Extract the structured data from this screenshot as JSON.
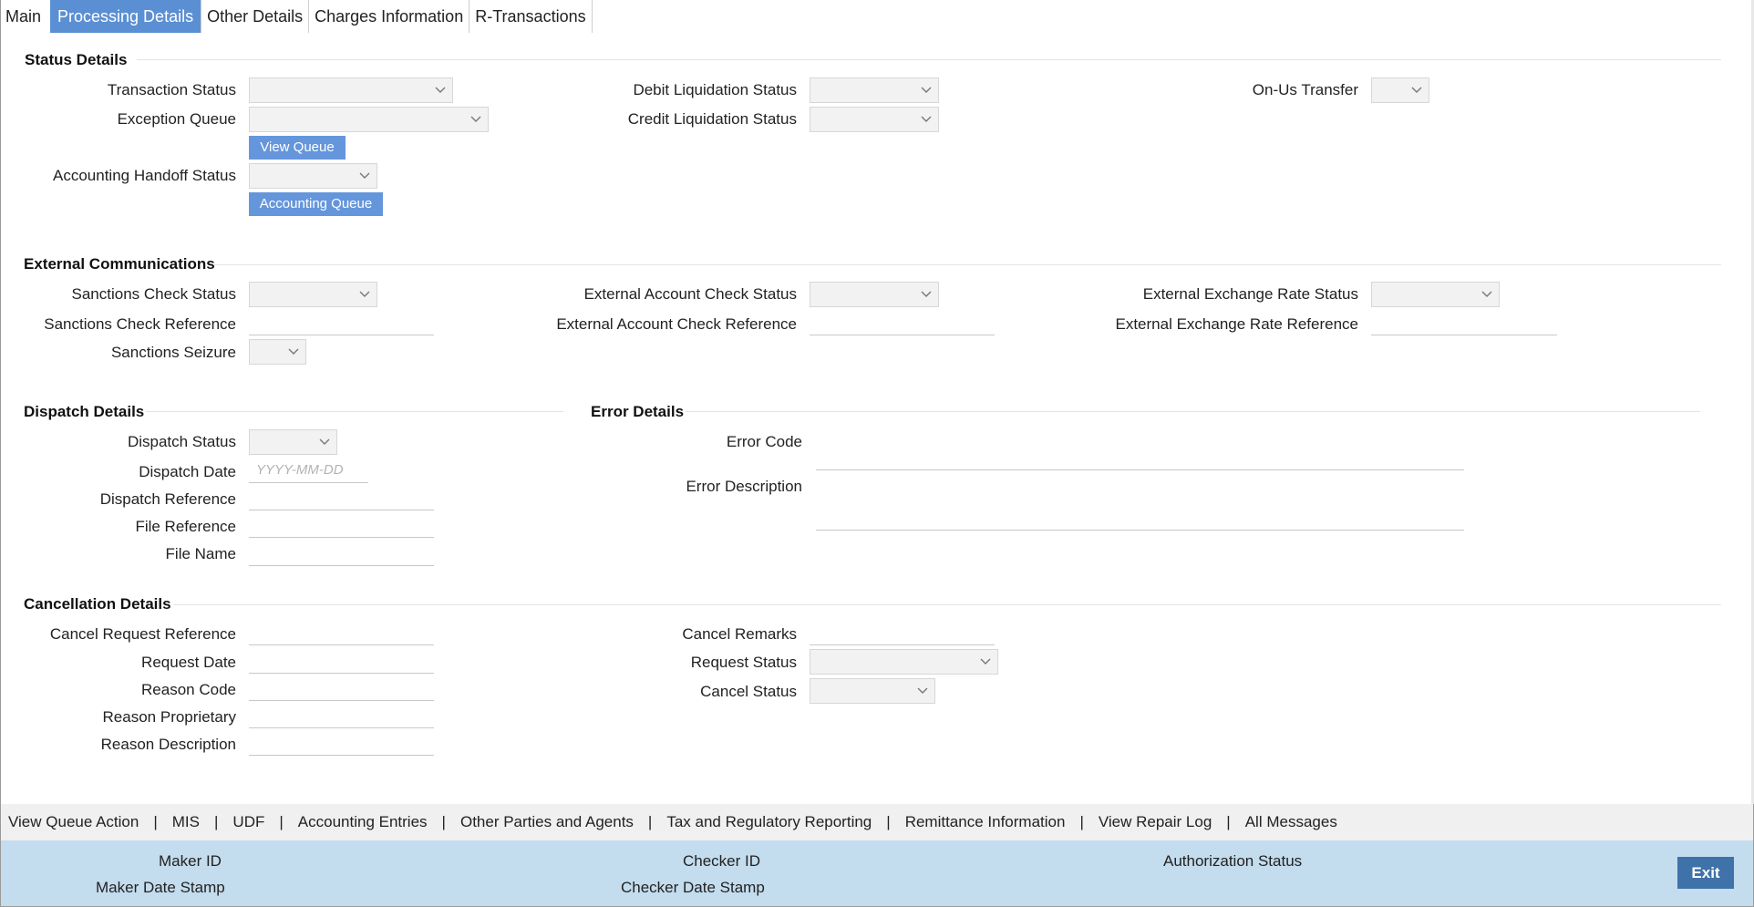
{
  "tabs": [
    {
      "label": "Main"
    },
    {
      "label": "Processing Details"
    },
    {
      "label": "Other Details"
    },
    {
      "label": "Charges Information"
    },
    {
      "label": "R-Transactions"
    }
  ],
  "status": {
    "title": "Status Details",
    "transaction_status": "Transaction Status",
    "exception_queue": "Exception Queue",
    "view_queue_btn": "View Queue",
    "accounting_handoff_status": "Accounting Handoff Status",
    "accounting_queue_btn": "Accounting Queue",
    "debit_liquidation_status": "Debit Liquidation Status",
    "credit_liquidation_status": "Credit Liquidation Status",
    "on_us_transfer": "On-Us Transfer"
  },
  "external": {
    "title": "External Communications",
    "sanctions_check_status": "Sanctions Check Status",
    "sanctions_check_reference": "Sanctions Check Reference",
    "sanctions_seizure": "Sanctions Seizure",
    "ext_account_check_status": "External Account Check Status",
    "ext_account_check_reference": "External Account Check Reference",
    "ext_exchange_rate_status": "External Exchange Rate Status",
    "ext_exchange_rate_reference": "External Exchange Rate Reference"
  },
  "dispatch": {
    "title": "Dispatch Details",
    "dispatch_status": "Dispatch Status",
    "dispatch_date": "Dispatch Date",
    "dispatch_date_placeholder": "YYYY-MM-DD",
    "dispatch_reference": "Dispatch Reference",
    "file_reference": "File Reference",
    "file_name": "File Name"
  },
  "error": {
    "title": "Error Details",
    "error_code": "Error Code",
    "error_description": "Error Description"
  },
  "cancellation": {
    "title": "Cancellation Details",
    "cancel_request_reference": "Cancel Request Reference",
    "request_date": "Request Date",
    "reason_code": "Reason Code",
    "reason_proprietary": "Reason Proprietary",
    "reason_description": "Reason Description",
    "cancel_remarks": "Cancel Remarks",
    "request_status": "Request Status",
    "cancel_status": "Cancel Status"
  },
  "links": [
    {
      "label": "View Queue Action"
    },
    {
      "label": "MIS"
    },
    {
      "label": "UDF"
    },
    {
      "label": "Accounting Entries"
    },
    {
      "label": "Other Parties and Agents"
    },
    {
      "label": "Tax and Regulatory Reporting"
    },
    {
      "label": "Remittance Information"
    },
    {
      "label": "View Repair Log"
    },
    {
      "label": "All Messages"
    }
  ],
  "link_separator": "|",
  "footer": {
    "maker_id": "Maker ID",
    "maker_date_stamp": "Maker Date Stamp",
    "checker_id": "Checker ID",
    "checker_date_stamp": "Checker Date Stamp",
    "authorization_status": "Authorization Status",
    "exit_label": "Exit"
  },
  "colors": {
    "active_tab": "#5b8fd3",
    "button": "#6596dc",
    "footer_bg": "#c3dcee",
    "exit_button": "#3f72a8"
  }
}
